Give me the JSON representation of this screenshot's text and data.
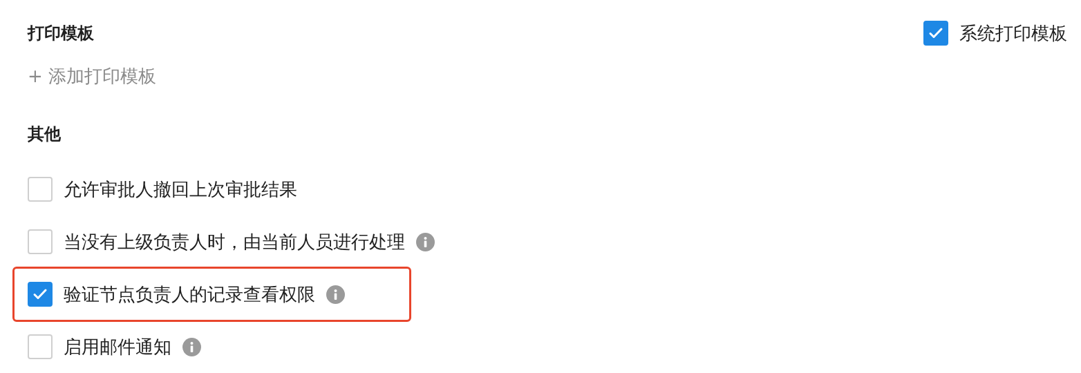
{
  "print_template": {
    "title": "打印模板",
    "system_template": {
      "label": "系统打印模板",
      "checked": true
    },
    "add_link": "+ 添加打印模板"
  },
  "other": {
    "title": "其他",
    "options": [
      {
        "label": "允许审批人撤回上次审批结果",
        "checked": false,
        "info": false,
        "highlighted": false
      },
      {
        "label": "当没有上级负责人时，由当前人员进行处理",
        "checked": false,
        "info": true,
        "highlighted": false
      },
      {
        "label": "验证节点负责人的记录查看权限",
        "checked": true,
        "info": true,
        "highlighted": true
      },
      {
        "label": "启用邮件通知",
        "checked": false,
        "info": true,
        "highlighted": false
      }
    ]
  }
}
